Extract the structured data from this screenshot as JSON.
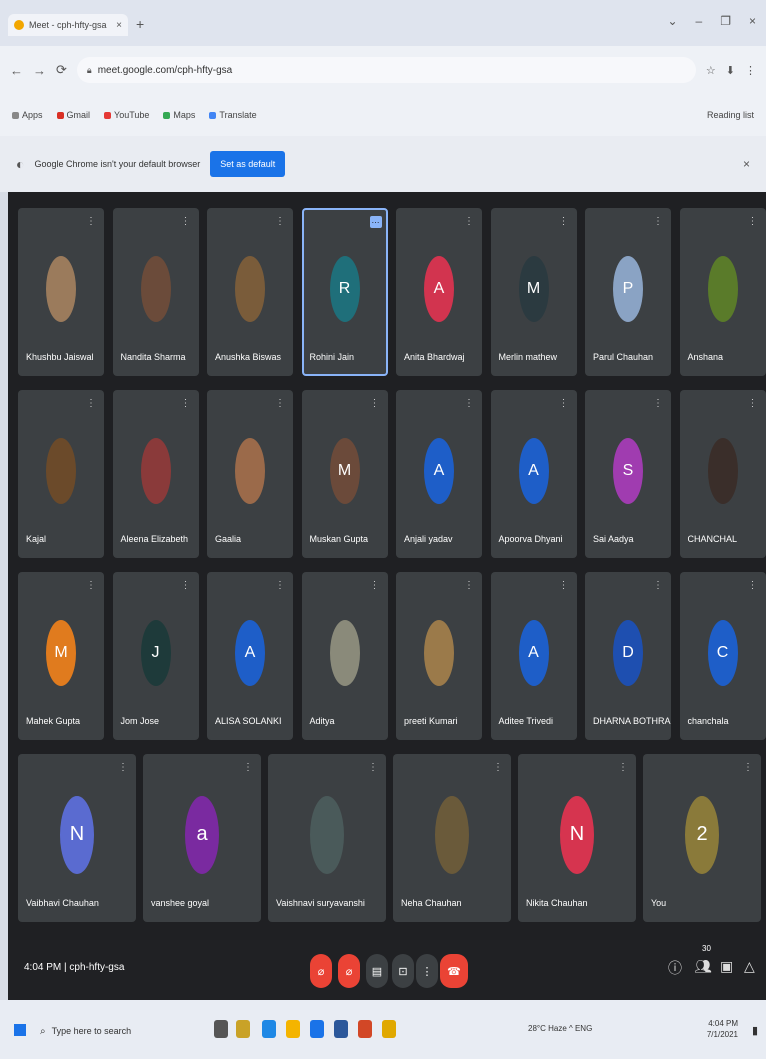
{
  "browser": {
    "tab_title": "Meet - cph-hfty-gsa",
    "tab_close": "×",
    "new_tab": "+",
    "window_controls": [
      "⌄",
      "–",
      "❐",
      "×"
    ],
    "nav": [
      "←",
      "→",
      "⟳"
    ],
    "url": "meet.google.com/cph-hfty-gsa",
    "address_icons": [
      "☆",
      "⬇",
      "⋮"
    ],
    "bookmarks": [
      "Apps",
      "Gmail",
      "YouTube",
      "Maps",
      "Translate"
    ],
    "bookmarks_right": "Reading list",
    "infobar_text": "Google Chrome isn't your default browser",
    "infobar_button": "Set as default",
    "infobar_close": "×"
  },
  "participants": [
    {
      "name": "Khushbu Jaiswal",
      "initial": "",
      "color": "#9b7b5c"
    },
    {
      "name": "Nandita Sharma",
      "initial": "",
      "color": "#6b4b3a"
    },
    {
      "name": "Anushka Biswas",
      "initial": "",
      "color": "#7a5c3a"
    },
    {
      "name": "Rohini Jain",
      "initial": "R",
      "color": "#1f6f7a"
    },
    {
      "name": "Anita Bhardwaj",
      "initial": "A",
      "color": "#d2344f"
    },
    {
      "name": "Merlin mathew",
      "initial": "M",
      "color": "#2b3a40"
    },
    {
      "name": "Parul Chauhan",
      "initial": "P",
      "color": "#8aa3c4"
    },
    {
      "name": "Anshana",
      "initial": "",
      "color": "#5a7b2a"
    },
    {
      "name": "Kajal",
      "initial": "",
      "color": "#6b4a2a"
    },
    {
      "name": "Aleena Elizabeth",
      "initial": "",
      "color": "#8a3a3a"
    },
    {
      "name": "Gaalia",
      "initial": "",
      "color": "#9b6a4a"
    },
    {
      "name": "Muskan Gupta",
      "initial": "M",
      "color": "#6b4a3a"
    },
    {
      "name": "Anjali yadav",
      "initial": "A",
      "color": "#1e5ec8"
    },
    {
      "name": "Apoorva Dhyani",
      "initial": "A",
      "color": "#1e5ec8"
    },
    {
      "name": "Sai Aadya",
      "initial": "S",
      "color": "#a03cb0"
    },
    {
      "name": "CHANCHAL",
      "initial": "",
      "color": "#3a2e2a"
    },
    {
      "name": "Mahek Gupta",
      "initial": "M",
      "color": "#e07b1e"
    },
    {
      "name": "Jom Jose",
      "initial": "J",
      "color": "#1e3a3a"
    },
    {
      "name": "ALISA SOLANKI",
      "initial": "A",
      "color": "#1e5ec8"
    },
    {
      "name": "Aditya",
      "initial": "",
      "color": "#8a8a7a"
    },
    {
      "name": "preeti Kumari",
      "initial": "",
      "color": "#9b7a4a"
    },
    {
      "name": "Aditee Trivedi",
      "initial": "A",
      "color": "#1e5ec8"
    },
    {
      "name": "DHARNA BOTHRA",
      "initial": "D",
      "color": "#1e4fb0"
    },
    {
      "name": "chanchala",
      "initial": "C",
      "color": "#1e5ec8"
    },
    {
      "name": "Vaibhavi Chauhan",
      "initial": "N",
      "color": "#5a6bd0"
    },
    {
      "name": "vanshee goyal",
      "initial": "a",
      "color": "#7a2aa0"
    },
    {
      "name": "Vaishnavi suryavanshi",
      "initial": "",
      "color": "#4a5a5a"
    },
    {
      "name": "Neha Chauhan",
      "initial": "",
      "color": "#6a5a3a"
    },
    {
      "name": "Nikita Chauhan",
      "initial": "N",
      "color": "#d6344f"
    },
    {
      "name": "You",
      "initial": "2",
      "color": "#8a7a3a"
    }
  ],
  "controls": {
    "meeting_info": "4:04 PM | cph-hfty-gsa",
    "mic_icon": "mic-off-icon",
    "cam_icon": "camera-off-icon",
    "end_call_color": "#ea4335",
    "muted_color": "#ea4335",
    "participant_count": "30"
  },
  "taskbar": {
    "search_placeholder": "Type here to search",
    "tray_text": "28°C Haze  ^  ENG",
    "time": "4:04 PM",
    "date": "7/1/2021"
  }
}
